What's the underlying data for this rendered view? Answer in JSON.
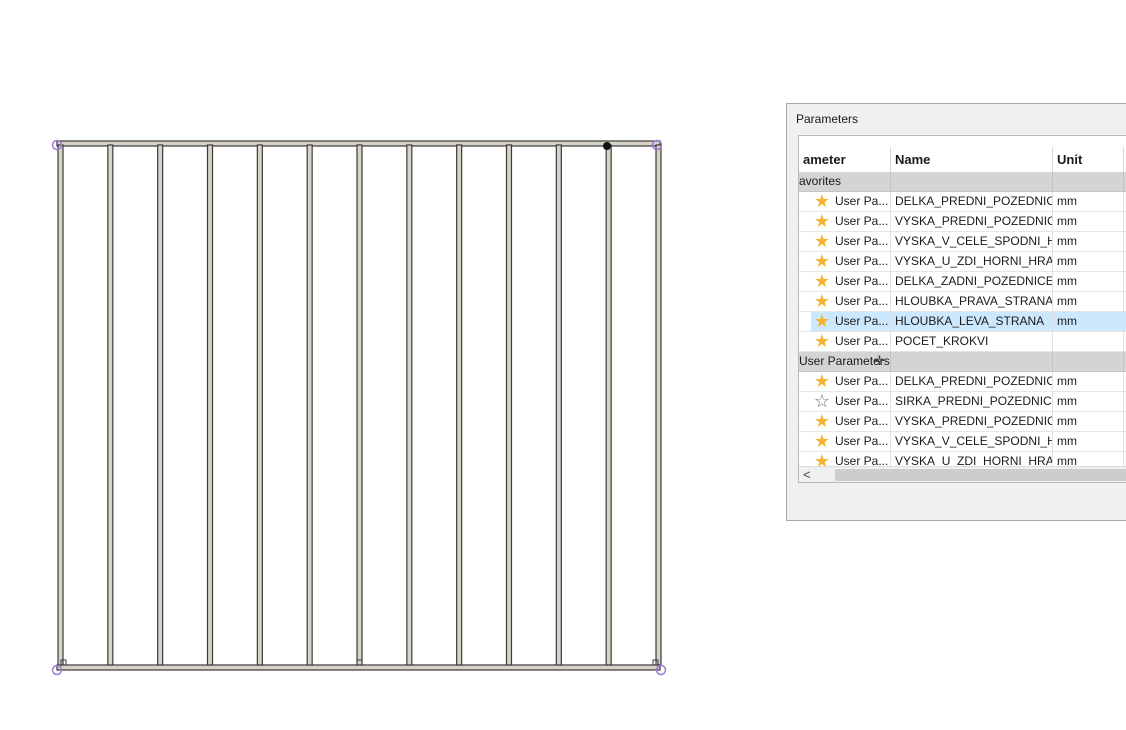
{
  "panel": {
    "title": "Parameters",
    "columns": [
      "ameter",
      "Name",
      "Unit"
    ],
    "groups": [
      {
        "label": "avorites",
        "rows": [
          {
            "source": "User Pa...",
            "name": "DELKA_PREDNI_POZEDNICE",
            "unit": "mm",
            "favorite": true
          },
          {
            "source": "User Pa...",
            "name": "VYSKA_PREDNI_POZEDNICE",
            "unit": "mm",
            "favorite": true
          },
          {
            "source": "User Pa...",
            "name": "VYSKA_V_CELE_SPODNI_HR...",
            "unit": "mm",
            "favorite": true
          },
          {
            "source": "User Pa...",
            "name": "VYSKA_U_ZDI_HORNI_HRA...",
            "unit": "mm",
            "favorite": true
          },
          {
            "source": "User Pa...",
            "name": "DELKA_ZADNI_POZEDNICE",
            "unit": "mm",
            "favorite": true
          },
          {
            "source": "User Pa...",
            "name": "HLOUBKA_PRAVA_STRANA",
            "unit": "mm",
            "favorite": true
          },
          {
            "source": "User Pa...",
            "name": "HLOUBKA_LEVA_STRANA",
            "unit": "mm",
            "favorite": true,
            "selected": true
          },
          {
            "source": "User Pa...",
            "name": "POCET_KROKVI",
            "unit": "",
            "favorite": true
          }
        ]
      },
      {
        "label": "User Parameters",
        "rows": [
          {
            "source": "User Pa...",
            "name": "DELKA_PREDNI_POZEDNICE",
            "unit": "mm",
            "favorite": true
          },
          {
            "source": "User Pa...",
            "name": "SIRKA_PREDNI_POZEDNICE",
            "unit": "mm",
            "favorite": false
          },
          {
            "source": "User Pa...",
            "name": "VYSKA_PREDNI_POZEDNICE",
            "unit": "mm",
            "favorite": true
          },
          {
            "source": "User Pa...",
            "name": "VYSKA_V_CELE_SPODNI_HR...",
            "unit": "mm",
            "favorite": true
          },
          {
            "source": "User Pa...",
            "name": "VYSKA_U_ZDI_HORNI_HRA...",
            "unit": "mm",
            "favorite": true
          }
        ]
      }
    ],
    "scroll_left_glyph": "<",
    "icons": {
      "favorite_on": "star-filled-icon",
      "favorite_off": "star-outline-icon"
    },
    "colors": {
      "star": "#f2b431",
      "selection": "#cce8ff",
      "group_bg": "#d4d4d4"
    }
  },
  "drawing": {
    "rafter_count": 13,
    "colors": {
      "frame": "#3a3a3a",
      "fill": "#d8d2c8",
      "handle": "#9b7ad6"
    }
  }
}
